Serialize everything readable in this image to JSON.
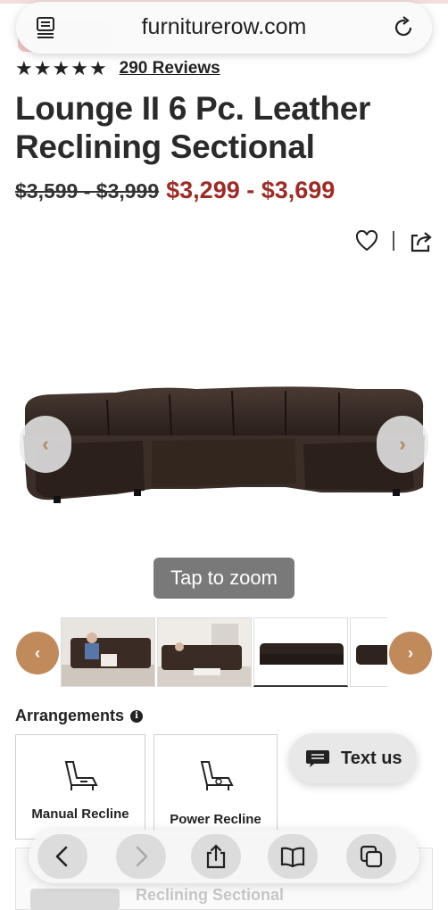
{
  "browser": {
    "url": "furniturerow.com",
    "icons": {
      "reader": "reader-mode-icon",
      "reload": "reload-icon"
    }
  },
  "product": {
    "rating_stars": 5,
    "reviews": "290 Reviews",
    "title": "Lounge II 6 Pc. Leather Reclining Sectional",
    "old_price": "$3,599 - $3,999",
    "new_price": "$3,299 - $3,699",
    "colors": {
      "sale": "#9e2b25",
      "accent": "#c08a5a"
    }
  },
  "gallery": {
    "zoom_hint": "Tap to zoom",
    "prev_arrow": "‹",
    "next_arrow": "›",
    "thumbnail_count_visible": 4
  },
  "arrangements": {
    "title": "Arrangements",
    "options": [
      {
        "label": "Manual Recline"
      },
      {
        "label": "Power Recline"
      }
    ]
  },
  "chat": {
    "label": "Text us"
  },
  "behind_toolbar": {
    "text": "Reclining Sectional"
  },
  "toolbar": {
    "buttons": [
      "back-icon",
      "forward-icon",
      "share-icon",
      "bookmarks-icon",
      "tabs-icon"
    ]
  }
}
